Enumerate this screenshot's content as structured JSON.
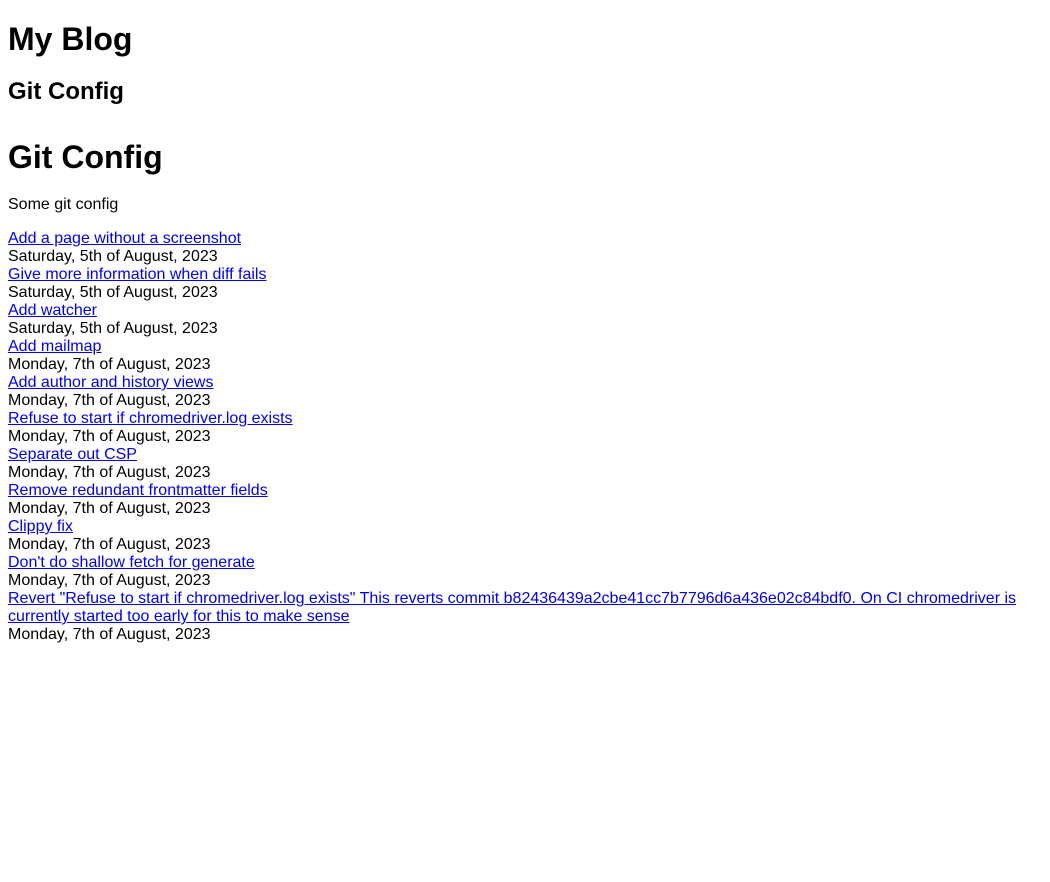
{
  "site": {
    "title": "My Blog"
  },
  "section": {
    "title": "Git Config"
  },
  "page": {
    "heading": "Git Config",
    "description": "Some git config"
  },
  "commits": [
    {
      "message": "Add a page without a screenshot",
      "date": "Saturday, 5th of August, 2023"
    },
    {
      "message": "Give more information when diff fails",
      "date": "Saturday, 5th of August, 2023"
    },
    {
      "message": "Add watcher",
      "date": "Saturday, 5th of August, 2023"
    },
    {
      "message": "Add mailmap",
      "date": "Monday, 7th of August, 2023"
    },
    {
      "message": "Add author and history views",
      "date": "Monday, 7th of August, 2023"
    },
    {
      "message": "Refuse to start if chromedriver.log exists",
      "date": "Monday, 7th of August, 2023"
    },
    {
      "message": "Separate out CSP",
      "date": "Monday, 7th of August, 2023"
    },
    {
      "message": "Remove redundant frontmatter fields",
      "date": "Monday, 7th of August, 2023"
    },
    {
      "message": "Clippy fix",
      "date": "Monday, 7th of August, 2023"
    },
    {
      "message": "Don't do shallow fetch for generate",
      "date": "Monday, 7th of August, 2023"
    },
    {
      "message": "Revert \"Refuse to start if chromedriver.log exists\" This reverts commit b82436439a2cbe41cc7b7796d6a436e02c84bdf0. On CI chromedriver is currently started too early for this to make sense",
      "date": "Monday, 7th of August, 2023"
    }
  ],
  "colors": {
    "link": "#0000ee",
    "text": "#000000",
    "background": "#ffffff"
  }
}
